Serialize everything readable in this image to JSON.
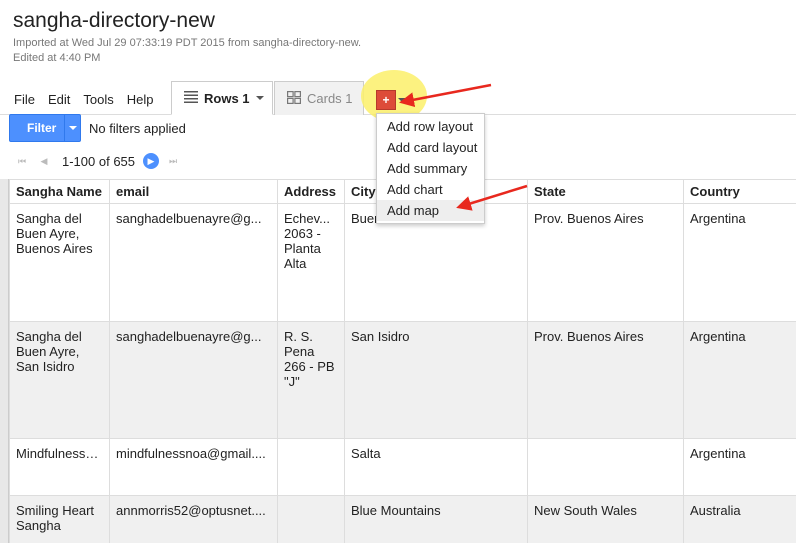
{
  "header": {
    "title": "sangha-directory-new",
    "imported": "Imported at Wed Jul 29 07:33:19 PDT 2015 from sangha-directory-new.",
    "edited": "Edited at 4:40 PM"
  },
  "menu": [
    "File",
    "Edit",
    "Tools",
    "Help"
  ],
  "tabs": {
    "rows_label": "Rows 1",
    "cards_label": "Cards 1",
    "add_icon": "+"
  },
  "filter": {
    "button_label": "Filter",
    "status": "No filters applied"
  },
  "pager": {
    "range": "1-100 of 655"
  },
  "dropdown": {
    "items": [
      "Add row layout",
      "Add card layout",
      "Add summary",
      "Add chart",
      "Add map"
    ]
  },
  "table": {
    "headers": [
      "Sangha Name",
      "email",
      "Address",
      "City",
      "State",
      "Country"
    ],
    "rows": [
      [
        "Sangha del Buen Ayre, Buenos Aires",
        "sanghadelbuenayre@g...",
        "Echev... 2063 - Planta Alta",
        "Buenos Aires",
        "Prov. Buenos Aires",
        "Argentina"
      ],
      [
        "Sangha del Buen Ayre, San Isidro",
        "sanghadelbuenayre@g...",
        "R. S. Pena 266 - PB \"J\"",
        "San Isidro",
        "Prov. Buenos Aires",
        "Argentina"
      ],
      [
        "Mindfulnessn...",
        "mindfulnessnoa@gmail....",
        "",
        "Salta",
        "",
        "Argentina"
      ],
      [
        "Smiling Heart Sangha",
        "annmorris52@optusnet....",
        "",
        "Blue Mountains",
        "New South Wales",
        "Australia"
      ]
    ]
  },
  "colors": {
    "accent": "#4d90fe",
    "add_button": "#dd4b39",
    "highlight": "#fbf06a",
    "annotation_arrow": "#e8281e"
  }
}
